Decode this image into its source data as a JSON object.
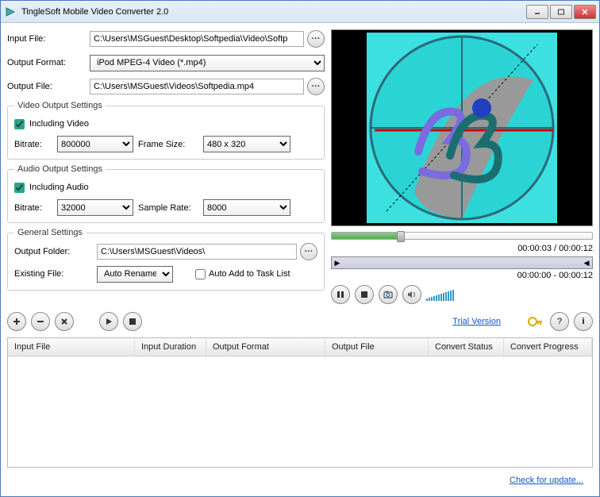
{
  "window": {
    "title": "TingleSoft Mobile Video Converter 2.0"
  },
  "form": {
    "input_label": "Input File:",
    "input_value": "C:\\Users\\MSGuest\\Desktop\\Softpedia\\Video\\Softp",
    "format_label": "Output Format:",
    "format_value": "iPod MPEG-4 Video (*.mp4)",
    "output_label": "Output File:",
    "output_value": "C:\\Users\\MSGuest\\Videos\\Softpedia.mp4"
  },
  "video_settings": {
    "legend": "Video Output Settings",
    "include_label": "Including Video",
    "bitrate_label": "Bitrate:",
    "bitrate_value": "800000",
    "framesize_label": "Frame Size:",
    "framesize_value": "480 x 320"
  },
  "audio_settings": {
    "legend": "Audio Output Settings",
    "include_label": "Including Audio",
    "bitrate_label": "Bitrate:",
    "bitrate_value": "32000",
    "samplerate_label": "Sample Rate:",
    "samplerate_value": "8000"
  },
  "general": {
    "legend": "General Settings",
    "folder_label": "Output Folder:",
    "folder_value": "C:\\Users\\MSGuest\\Videos\\",
    "existing_label": "Existing File:",
    "existing_value": "Auto Rename",
    "auto_add_label": "Auto Add to Task List"
  },
  "preview": {
    "elapsed_total": "00:00:03 / 00:00:12",
    "trim_range": "00:00:00 - 00:00:12"
  },
  "links": {
    "trial": "Trial Version",
    "update": "Check for update..."
  },
  "table": {
    "cols": [
      "Input File",
      "Input Duration",
      "Output Format",
      "Output File",
      "Convert Status",
      "Convert Progress"
    ]
  }
}
